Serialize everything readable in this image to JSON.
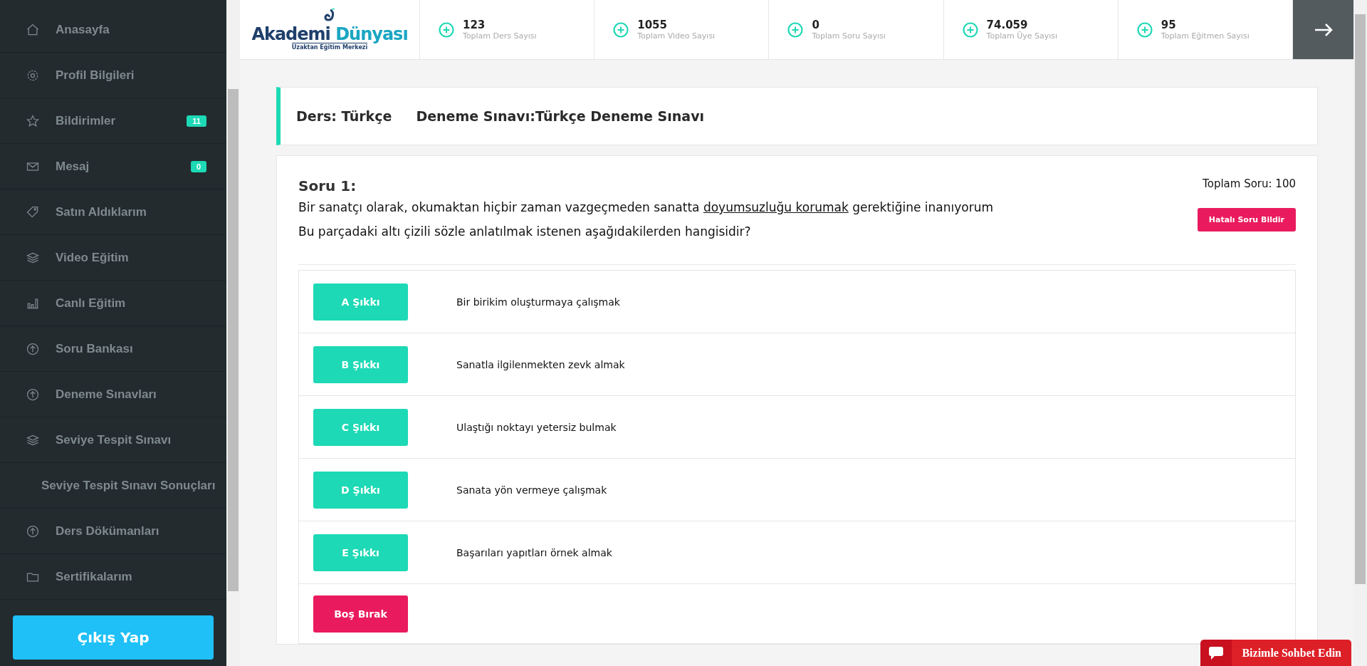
{
  "sidebar": {
    "items": [
      {
        "label": "Anasayfa",
        "selected": false
      },
      {
        "label": "Profil Bilgileri",
        "selected": false
      },
      {
        "label": "Bildirimler",
        "selected": false,
        "badge": "11"
      },
      {
        "label": "Mesaj",
        "selected": false,
        "badge": "0"
      },
      {
        "label": "Satın Aldıklarım",
        "selected": false
      },
      {
        "label": "Video Eğitim",
        "selected": false
      },
      {
        "label": "Canlı Eğitim",
        "selected": false
      },
      {
        "label": "Soru Bankası",
        "selected": false
      },
      {
        "label": "Deneme Sınavları",
        "selected": false
      },
      {
        "label": "Seviye Tespit Sınavı",
        "selected": false
      },
      {
        "label": "Seviye Tespit Sınavı Sonuçları",
        "selected": false
      },
      {
        "label": "Ders Dökümanları",
        "selected": false
      },
      {
        "label": "Sertifikalarım",
        "selected": false
      }
    ],
    "logout": "Çıkış Yap"
  },
  "header": {
    "logo": {
      "name": "Akademi",
      "name_accent": "Dünyası",
      "tagline": "Uzaktan Eğitim Merkezi"
    },
    "stats": [
      {
        "value": "123",
        "label": "Toplam Ders Sayısı"
      },
      {
        "value": "1055",
        "label": "Toplam Video Sayısı"
      },
      {
        "value": "0",
        "label": "Toplam Soru Sayısı"
      },
      {
        "value": "74.059",
        "label": "Toplam Üye Sayısı"
      },
      {
        "value": "95",
        "label": "Toplam Eğitmen Sayısı"
      }
    ]
  },
  "exam_title": {
    "course": "Ders: Türkçe",
    "exam": "Deneme Sınavı:Türkçe Deneme Sınavı"
  },
  "question": {
    "number": "Soru 1:",
    "text_parts": [
      {
        "text": "Bir sanatçı olarak, okumaktan hiçbir zaman vazgeçmeden sanatta ",
        "underlined": false
      },
      {
        "text": "doyumsuzluğu korumak",
        "underlined": true
      },
      {
        "text": " gerektiğine inanıyorum",
        "underlined": false
      }
    ],
    "prompt": "Bu parçadaki altı çizili sözle anlatılmak istenen aşağıdakilerden hangisidir?",
    "total": "Toplam Soru: 100",
    "report_button": "Hatalı Soru Bildir"
  },
  "options": [
    {
      "kind": "answer",
      "button": "A Şıkkı",
      "text": "Bir birikim oluşturmaya çalışmak"
    },
    {
      "kind": "answer",
      "button": "B Şıkkı",
      "text": "Sanatla ilgilenmekten zevk almak"
    },
    {
      "kind": "answer",
      "button": "C Şıkkı",
      "text": "Ulaştığı noktayı yetersiz bulmak"
    },
    {
      "kind": "answer",
      "button": "D Şıkkı",
      "text": "Sanata yön vermeye çalışmak"
    },
    {
      "kind": "answer",
      "button": "E Şıkkı",
      "text": "Başarıları yapıtları örnek almak"
    },
    {
      "kind": "skip",
      "button": "Boş Bırak"
    }
  ],
  "chat": {
    "label": "Bizimle Sohbet Edin"
  }
}
